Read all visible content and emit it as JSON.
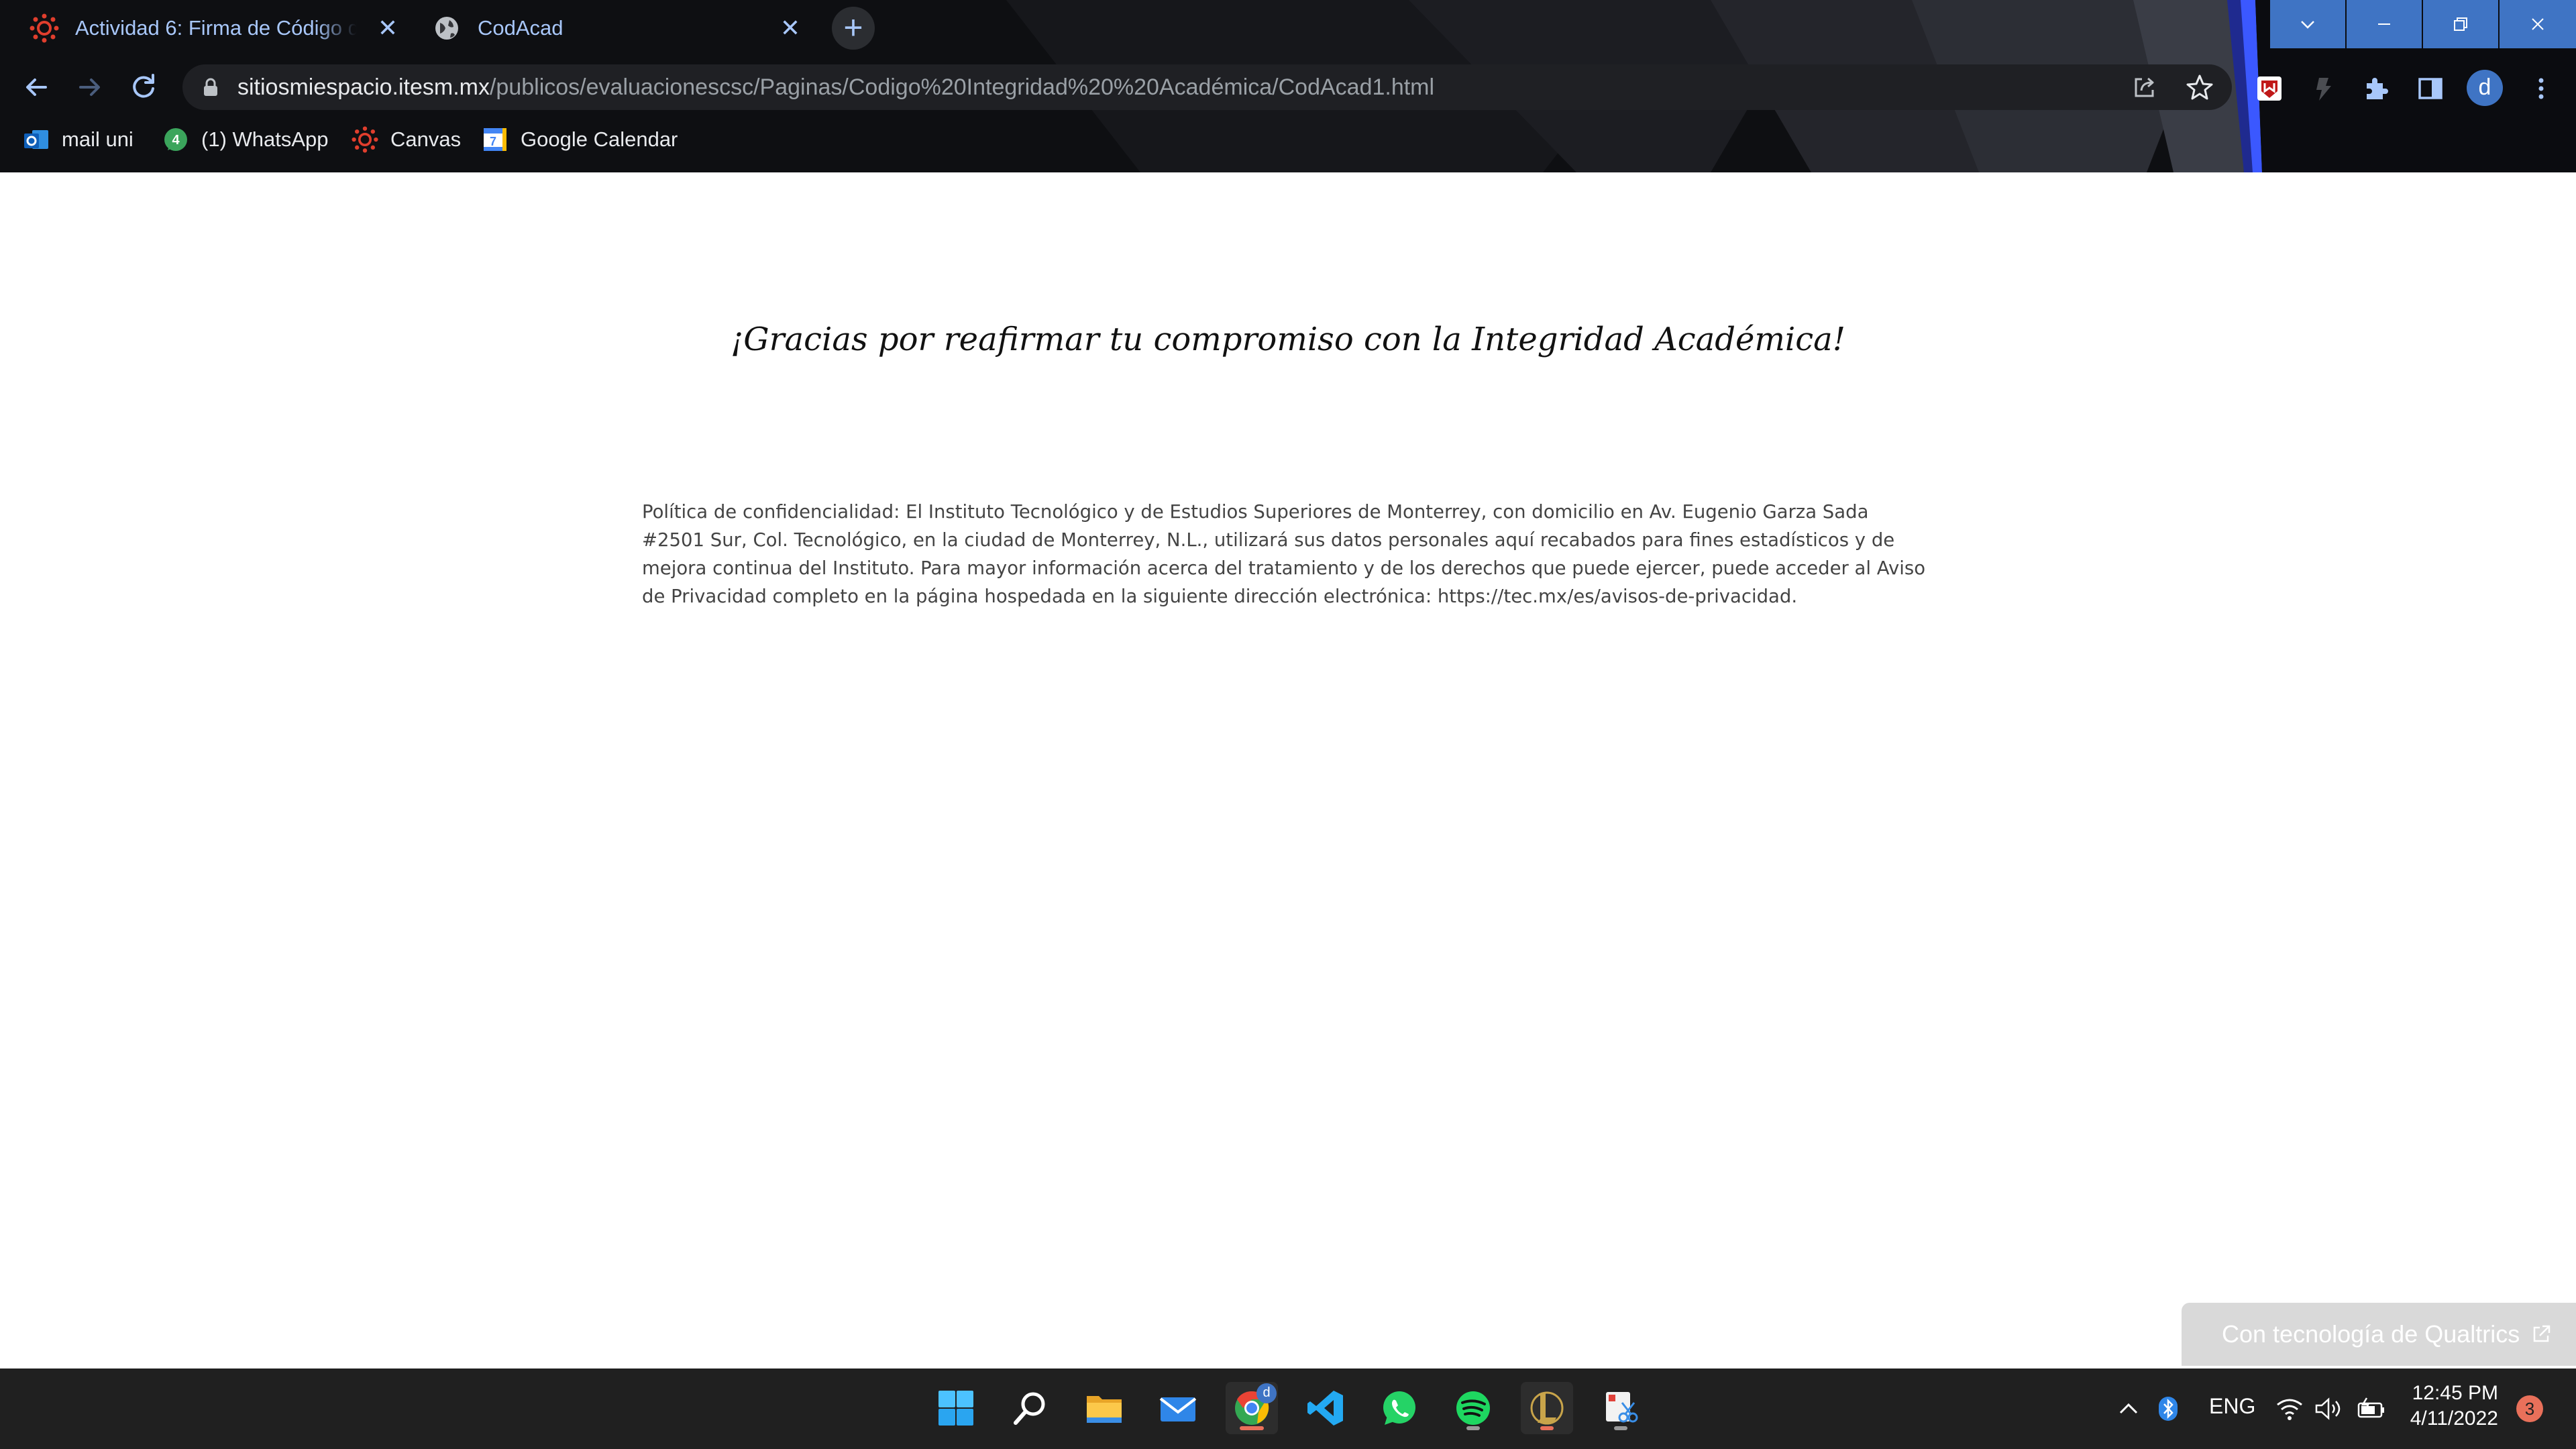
{
  "browser": {
    "tabs": [
      {
        "title": "Actividad 6: Firma de Código de",
        "icon": "canvas-icon"
      },
      {
        "title": "CodAcad",
        "icon": "globe-icon"
      }
    ],
    "new_tab_label": "+",
    "url": {
      "host": "sitiosmiespacio.itesm.mx",
      "path": "/publicos/evaluacionescsc/Paginas/Codigo%20Integridad%20%20Académica/CodAcad1.html"
    },
    "profile_initial": "d",
    "bookmarks": [
      {
        "label": "mail uni",
        "icon": "outlook-icon"
      },
      {
        "label": "(1) WhatsApp",
        "icon": "whatsapp-icon"
      },
      {
        "label": "Canvas",
        "icon": "canvas-icon"
      },
      {
        "label": "Google Calendar",
        "icon": "calendar-icon"
      }
    ]
  },
  "page": {
    "heading": "¡Gracias por reafirmar tu compromiso con la Integridad Académica!",
    "policy_text": "Política de confidencialidad: El Instituto Tecnológico y de Estudios Superiores de Monterrey, con domicilio en Av. Eugenio Garza Sada #2501 Sur, Col. Tecnológico, en la ciudad de Monterrey, N.L., utilizará sus datos personales aquí recabados para fines estadísticos y de mejora continua del Instituto. Para mayor información acerca del tratamiento y de los derechos que puede ejercer, puede acceder al Aviso de Privacidad completo en la página hospedada en la siguiente dirección electrónica: https://tec.mx/es/avisos-de-privacidad.",
    "qualtrics_badge": "Con tecnología de Qualtrics"
  },
  "taskbar": {
    "apps": [
      "start-icon",
      "search-icon",
      "file-explorer-icon",
      "mail-icon",
      "chrome-icon",
      "vscode-icon",
      "whatsapp-icon",
      "spotify-icon",
      "league-of-legends-icon",
      "snipping-tool-icon"
    ],
    "chrome_badge": "d",
    "language": "ENG",
    "time": "12:45 PM",
    "date": "4/11/2022",
    "notifications": "3"
  },
  "colors": {
    "accent_blue": "#3f74c4",
    "tab_text": "#a8c7fa",
    "chrome_bg": "#0e0f12",
    "taskbar_bg": "#202020",
    "notification_badge": "#e9705a"
  }
}
